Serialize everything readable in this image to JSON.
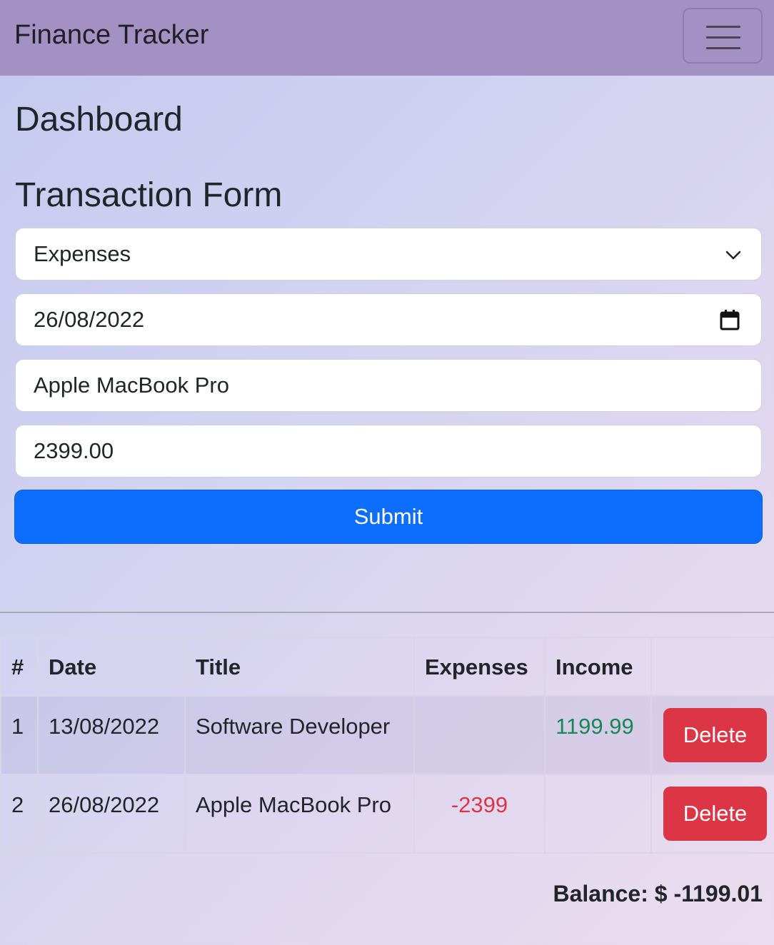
{
  "navbar": {
    "brand": "Finance Tracker",
    "menu_icon": "hamburger-icon"
  },
  "headings": {
    "dashboard": "Dashboard",
    "form": "Transaction Form"
  },
  "form": {
    "type_value": "Expenses",
    "date_value": "26/08/2022",
    "title_value": "Apple MacBook Pro",
    "amount_value": "2399.00",
    "submit_label": "Submit"
  },
  "table": {
    "headers": [
      "#",
      "Date",
      "Title",
      "Expenses",
      "Income",
      ""
    ],
    "rows": [
      {
        "num": "1",
        "date": "13/08/2022",
        "title": "Software Developer",
        "expenses": "",
        "income": "1199.99",
        "delete_label": "Delete"
      },
      {
        "num": "2",
        "date": "26/08/2022",
        "title": "Apple MacBook Pro",
        "expenses": "-2399",
        "income": "",
        "delete_label": "Delete"
      }
    ]
  },
  "balance": "Balance: $ -1199.01",
  "colors": {
    "navbar": "#a491c3",
    "primary": "#0d6efd",
    "danger": "#dc3545",
    "success": "#198754"
  }
}
